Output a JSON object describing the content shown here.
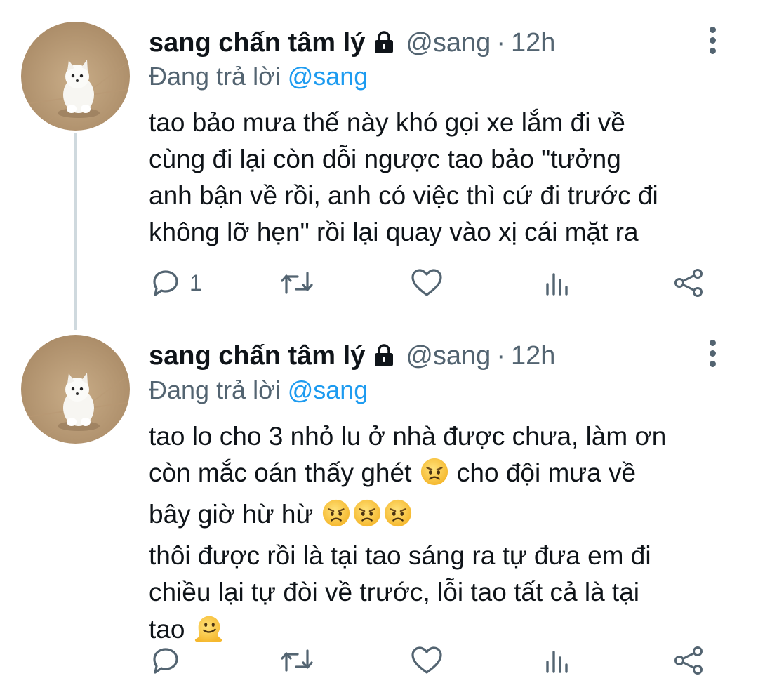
{
  "tweets": [
    {
      "display_name": "sang chấn tâm lý",
      "handle": "@sang",
      "separator": "·",
      "time": "12h",
      "replying_prefix": "Đang trả lời",
      "replying_to": "@sang",
      "lines": [
        "tao bảo mưa thế này khó gọi xe lắm đi về",
        "cùng đi lại còn dỗi ngược tao bảo \"tưởng",
        "anh bận về rồi, anh có việc thì cứ đi trước đi",
        "không lỡ hẹn\" rồi lại quay vào xị cái mặt ra"
      ],
      "reply_count": "1"
    },
    {
      "display_name": "sang chấn tâm lý",
      "handle": "@sang",
      "separator": "·",
      "time": "12h",
      "replying_prefix": "Đang trả lời",
      "replying_to": "@sang",
      "line1": "tao lo cho 3 nhỏ lu ở nhà được chưa, làm ơn",
      "line2a": "còn mắc oán thấy ghét",
      "line2b": "cho đội mưa về",
      "line3": "bây giờ hừ hừ",
      "line4": "thôi được rồi là tại tao sáng ra tự đưa em đi",
      "line5": "chiều lại tự đòi về trước, lỗi tao tất cả là tại",
      "line6": "tao",
      "reply_count": ""
    }
  ],
  "icons": {
    "lock": "lock-icon",
    "more": "more-vertical-icon",
    "reply": "reply-bubble-icon",
    "retweet": "retweet-icon",
    "like": "heart-icon",
    "analytics": "analytics-icon",
    "share": "share-icon",
    "emoji_angry": "angry-face-emoji",
    "emoji_melting": "melting-face-emoji"
  },
  "colors": {
    "text": "#0f1419",
    "secondary": "#536471",
    "accent": "#1d9bf0",
    "thread_line": "#cfd9de"
  }
}
